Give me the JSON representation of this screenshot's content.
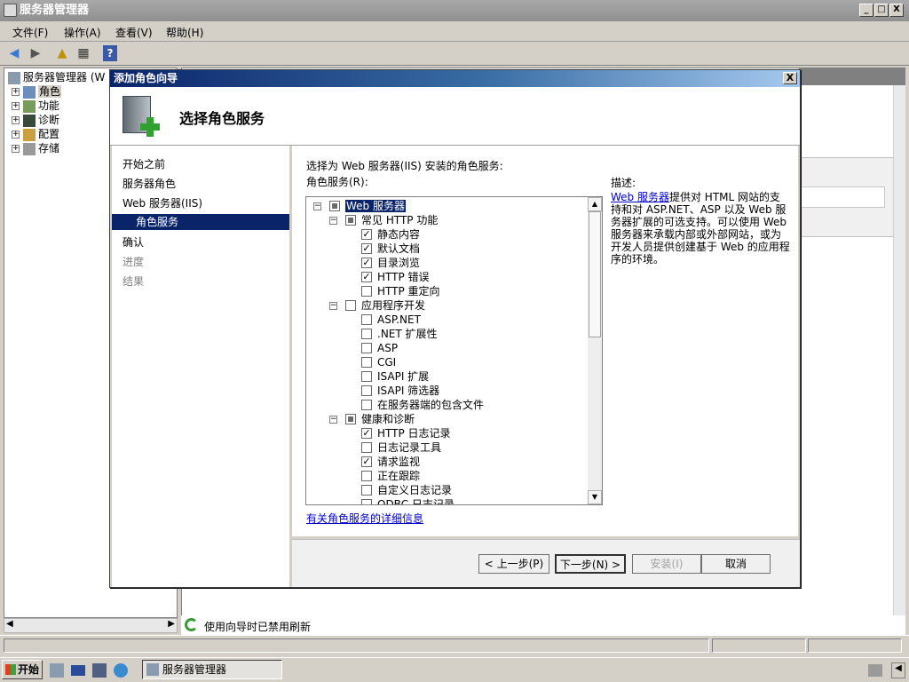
{
  "window": {
    "title": "服务器管理器",
    "minimize": "_",
    "maximize": "□",
    "close": "X"
  },
  "menu": [
    "文件(F)",
    "操作(A)",
    "查看(V)",
    "帮助(H)"
  ],
  "tree": {
    "root": "服务器管理器 (W",
    "items": [
      "角色",
      "功能",
      "诊断",
      "配置",
      "存储"
    ]
  },
  "status": {
    "refresh_text": "使用向导时已禁用刷新"
  },
  "taskbar": {
    "start": "开始",
    "task": "服务器管理器"
  },
  "dialog": {
    "title": "添加角色向导",
    "heading": "选择角色服务",
    "close": "X",
    "steps": [
      {
        "label": "开始之前",
        "state": "normal"
      },
      {
        "label": "服务器角色",
        "state": "normal"
      },
      {
        "label": "Web 服务器(IIS)",
        "state": "normal"
      },
      {
        "label": "角色服务",
        "state": "active"
      },
      {
        "label": "确认",
        "state": "normal"
      },
      {
        "label": "进度",
        "state": "disabled"
      },
      {
        "label": "结果",
        "state": "disabled"
      }
    ],
    "instruction": "选择为 Web 服务器(IIS) 安装的角色服务:",
    "list_label": "角色服务(R):",
    "services": [
      {
        "label": "Web 服务器",
        "level": 0,
        "state": "partial",
        "toggle": "−",
        "selected": true
      },
      {
        "label": "常见 HTTP 功能",
        "level": 1,
        "state": "partial",
        "toggle": "−"
      },
      {
        "label": "静态内容",
        "level": 2,
        "state": "checked"
      },
      {
        "label": "默认文档",
        "level": 2,
        "state": "checked"
      },
      {
        "label": "目录浏览",
        "level": 2,
        "state": "checked"
      },
      {
        "label": "HTTP 错误",
        "level": 2,
        "state": "checked"
      },
      {
        "label": "HTTP 重定向",
        "level": 2,
        "state": "unchecked"
      },
      {
        "label": "应用程序开发",
        "level": 1,
        "state": "unchecked",
        "toggle": "−"
      },
      {
        "label": "ASP.NET",
        "level": 2,
        "state": "unchecked"
      },
      {
        "label": ".NET 扩展性",
        "level": 2,
        "state": "unchecked"
      },
      {
        "label": "ASP",
        "level": 2,
        "state": "unchecked"
      },
      {
        "label": "CGI",
        "level": 2,
        "state": "unchecked"
      },
      {
        "label": "ISAPI 扩展",
        "level": 2,
        "state": "unchecked"
      },
      {
        "label": "ISAPI 筛选器",
        "level": 2,
        "state": "unchecked"
      },
      {
        "label": "在服务器端的包含文件",
        "level": 2,
        "state": "unchecked"
      },
      {
        "label": "健康和诊断",
        "level": 1,
        "state": "partial",
        "toggle": "−"
      },
      {
        "label": "HTTP 日志记录",
        "level": 2,
        "state": "checked"
      },
      {
        "label": "日志记录工具",
        "level": 2,
        "state": "unchecked"
      },
      {
        "label": "请求监视",
        "level": 2,
        "state": "checked"
      },
      {
        "label": "正在跟踪",
        "level": 2,
        "state": "unchecked"
      },
      {
        "label": "自定义日志记录",
        "level": 2,
        "state": "unchecked"
      },
      {
        "label": "ODBC 日志记录",
        "level": 2,
        "state": "unchecked"
      }
    ],
    "description_title": "描述:",
    "description_link": "Web 服务器",
    "description_text": "提供对 HTML 网站的支持和对 ASP.NET、ASP 以及 Web 服务器扩展的可选支持。可以使用 Web 服务器来承载内部或外部网站，或为开发人员提供创建基于 Web 的应用程序的环境。",
    "more_info_link": "有关角色服务的详细信息",
    "buttons": {
      "prev": "< 上一步(P)",
      "next": "下一步(N) >",
      "install": "安装(I)",
      "cancel": "取消"
    }
  }
}
